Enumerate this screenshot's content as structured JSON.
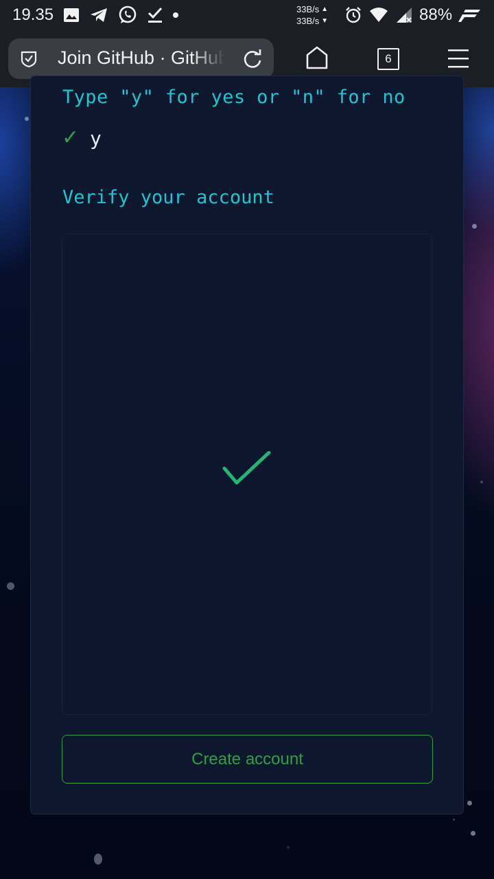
{
  "status_bar": {
    "time": "19.35",
    "net_up": "33B/s",
    "net_down": "33B/s",
    "battery": "88%",
    "icons": [
      "image-icon",
      "telegram-icon",
      "whatsapp-icon",
      "download-done-icon",
      "dot-icon",
      "alarm-icon",
      "wifi-icon",
      "signal-icon",
      "brand-icon"
    ]
  },
  "browser": {
    "tab_title": "Join GitHub · GitHub",
    "tab_count": "6"
  },
  "terminal": {
    "prompt": "Type \"y\" for yes or \"n\" for no",
    "answer": "y",
    "answer_mark": "✓",
    "verify_title": "Verify your account"
  },
  "actions": {
    "create_account": "Create account"
  },
  "colors": {
    "accent_cyan": "#1cc7d0",
    "success_green": "#2ea043",
    "card_bg": "#0d172d",
    "page_bg": "#040a1c"
  }
}
